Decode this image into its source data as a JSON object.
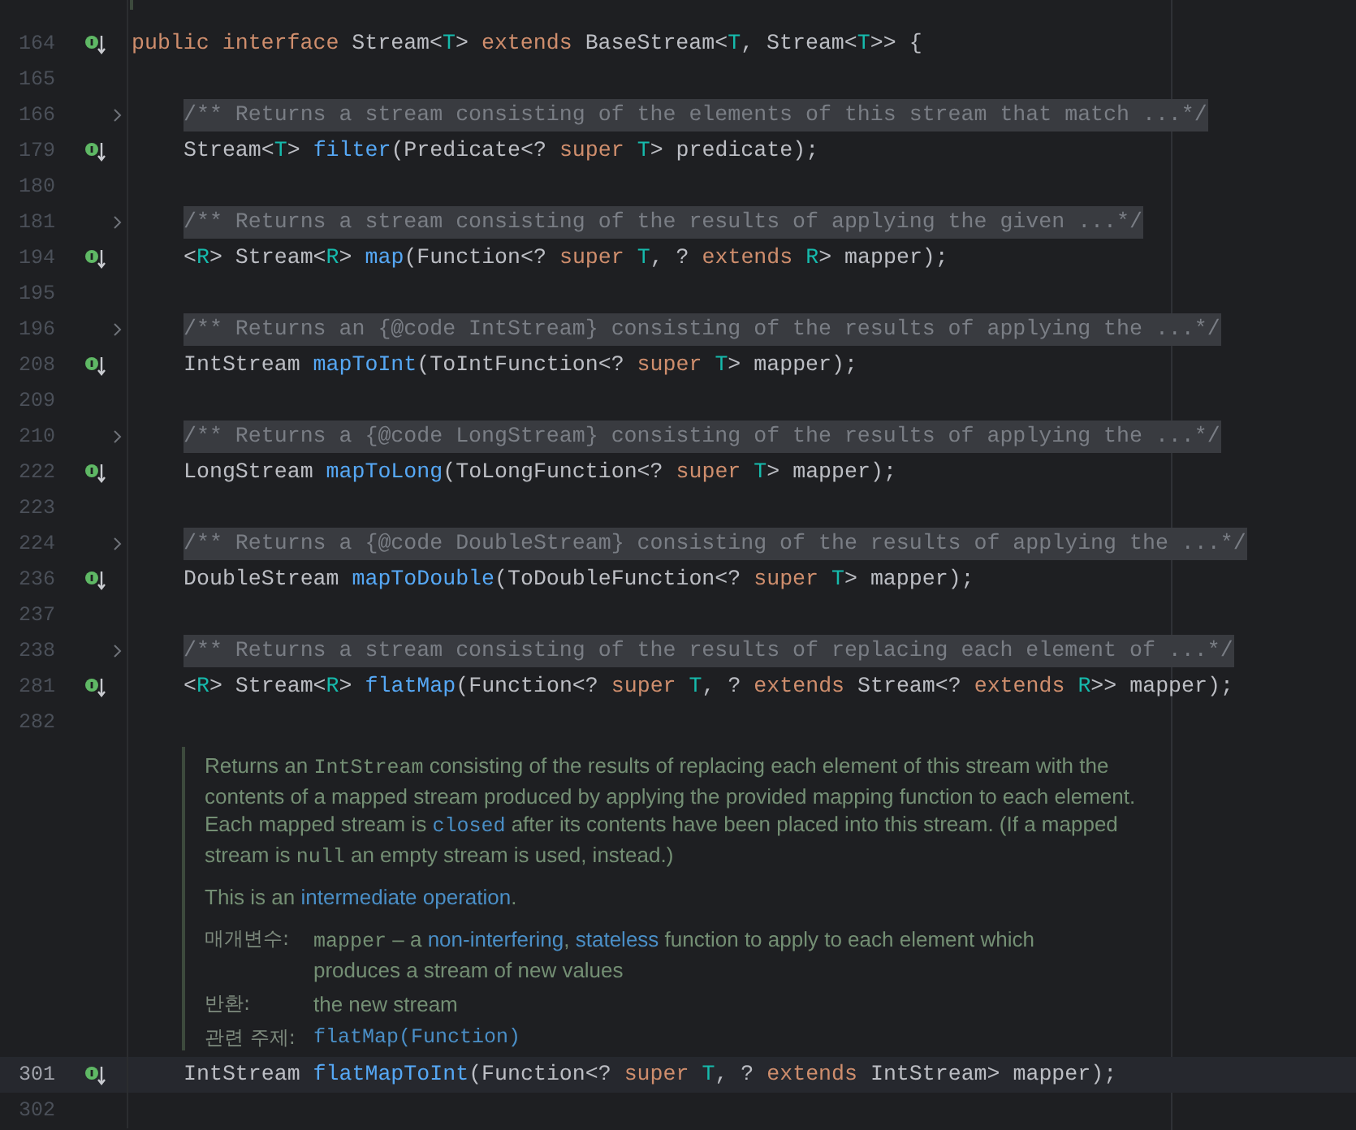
{
  "editor": {
    "lines": [
      {
        "kind": "code",
        "number": "164",
        "implemented": true,
        "tokens": [
          {
            "text": "public ",
            "kind": "keyword"
          },
          {
            "text": "interface ",
            "kind": "keyword"
          },
          {
            "text": "Stream<",
            "kind": "plain"
          },
          {
            "text": "T",
            "kind": "typeparam"
          },
          {
            "text": "> ",
            "kind": "plain"
          },
          {
            "text": "extends ",
            "kind": "keyword"
          },
          {
            "text": "BaseStream<",
            "kind": "plain"
          },
          {
            "text": "T",
            "kind": "typeparam"
          },
          {
            "text": ", Stream<",
            "kind": "plain"
          },
          {
            "text": "T",
            "kind": "typeparam"
          },
          {
            "text": ">> {",
            "kind": "plain"
          }
        ],
        "children": [
          {
            "kind": "blank",
            "number": "165"
          },
          {
            "kind": "folded",
            "number": "166",
            "text": "/** Returns a stream consisting of the elements of this stream that match ...*/"
          },
          {
            "kind": "code",
            "number": "179",
            "implemented": true,
            "tokens": [
              {
                "text": "Stream<",
                "kind": "plain"
              },
              {
                "text": "T",
                "kind": "typeparam"
              },
              {
                "text": "> ",
                "kind": "plain"
              },
              {
                "text": "filter",
                "kind": "method"
              },
              {
                "text": "(Predicate<? ",
                "kind": "plain"
              },
              {
                "text": "super ",
                "kind": "keyword"
              },
              {
                "text": "T",
                "kind": "typeparam"
              },
              {
                "text": "> predicate);",
                "kind": "plain"
              }
            ]
          },
          {
            "kind": "blank",
            "number": "180"
          },
          {
            "kind": "folded",
            "number": "181",
            "text": "/** Returns a stream consisting of the results of applying the given ...*/"
          },
          {
            "kind": "code",
            "number": "194",
            "implemented": true,
            "tokens": [
              {
                "text": "<",
                "kind": "plain"
              },
              {
                "text": "R",
                "kind": "typeparam"
              },
              {
                "text": "> Stream<",
                "kind": "plain"
              },
              {
                "text": "R",
                "kind": "typeparam"
              },
              {
                "text": "> ",
                "kind": "plain"
              },
              {
                "text": "map",
                "kind": "method"
              },
              {
                "text": "(Function<? ",
                "kind": "plain"
              },
              {
                "text": "super ",
                "kind": "keyword"
              },
              {
                "text": "T",
                "kind": "typeparam"
              },
              {
                "text": ", ? ",
                "kind": "plain"
              },
              {
                "text": "extends ",
                "kind": "keyword"
              },
              {
                "text": "R",
                "kind": "typeparam"
              },
              {
                "text": "> mapper);",
                "kind": "plain"
              }
            ]
          },
          {
            "kind": "blank",
            "number": "195"
          },
          {
            "kind": "folded",
            "number": "196",
            "text": "/** Returns an {@code IntStream} consisting of the results of applying the ...*/"
          },
          {
            "kind": "code",
            "number": "208",
            "implemented": true,
            "tokens": [
              {
                "text": "IntStream ",
                "kind": "plain"
              },
              {
                "text": "mapToInt",
                "kind": "method"
              },
              {
                "text": "(ToIntFunction<? ",
                "kind": "plain"
              },
              {
                "text": "super ",
                "kind": "keyword"
              },
              {
                "text": "T",
                "kind": "typeparam"
              },
              {
                "text": "> mapper);",
                "kind": "plain"
              }
            ]
          },
          {
            "kind": "blank",
            "number": "209"
          },
          {
            "kind": "folded",
            "number": "210",
            "text": "/** Returns a {@code LongStream} consisting of the results of applying the ...*/"
          },
          {
            "kind": "code",
            "number": "222",
            "implemented": true,
            "tokens": [
              {
                "text": "LongStream ",
                "kind": "plain"
              },
              {
                "text": "mapToLong",
                "kind": "method"
              },
              {
                "text": "(ToLongFunction<? ",
                "kind": "plain"
              },
              {
                "text": "super ",
                "kind": "keyword"
              },
              {
                "text": "T",
                "kind": "typeparam"
              },
              {
                "text": "> mapper);",
                "kind": "plain"
              }
            ]
          },
          {
            "kind": "blank",
            "number": "223"
          },
          {
            "kind": "folded",
            "number": "224",
            "text": "/** Returns a {@code DoubleStream} consisting of the results of applying the ...*/"
          },
          {
            "kind": "code",
            "number": "236",
            "implemented": true,
            "tokens": [
              {
                "text": "DoubleStream ",
                "kind": "plain"
              },
              {
                "text": "mapToDouble",
                "kind": "method"
              },
              {
                "text": "(ToDoubleFunction<? ",
                "kind": "plain"
              },
              {
                "text": "super ",
                "kind": "keyword"
              },
              {
                "text": "T",
                "kind": "typeparam"
              },
              {
                "text": "> mapper);",
                "kind": "plain"
              }
            ]
          },
          {
            "kind": "blank",
            "number": "237"
          },
          {
            "kind": "folded",
            "number": "238",
            "text": "/** Returns a stream consisting of the results of replacing each element of ...*/"
          },
          {
            "kind": "code",
            "number": "281",
            "implemented": true,
            "tokens": [
              {
                "text": "<",
                "kind": "plain"
              },
              {
                "text": "R",
                "kind": "typeparam"
              },
              {
                "text": "> Stream<",
                "kind": "plain"
              },
              {
                "text": "R",
                "kind": "typeparam"
              },
              {
                "text": "> ",
                "kind": "plain"
              },
              {
                "text": "flatMap",
                "kind": "method"
              },
              {
                "text": "(Function<? ",
                "kind": "plain"
              },
              {
                "text": "super ",
                "kind": "keyword"
              },
              {
                "text": "T",
                "kind": "typeparam"
              },
              {
                "text": ", ? ",
                "kind": "plain"
              },
              {
                "text": "extends ",
                "kind": "keyword"
              },
              {
                "text": "Stream<? ",
                "kind": "plain"
              },
              {
                "text": "extends ",
                "kind": "keyword"
              },
              {
                "text": "R",
                "kind": "typeparam"
              },
              {
                "text": ">> mapper);",
                "kind": "plain"
              }
            ]
          },
          {
            "kind": "blank",
            "number": "282"
          },
          {
            "kind": "doc",
            "paragraphs": [
              [
                {
                  "text": "Returns an ",
                  "kind": "text"
                },
                {
                  "text": "IntStream",
                  "kind": "code"
                },
                {
                  "text": " consisting of the results of replacing each element of this stream with the contents of a mapped stream produced by applying the provided mapping function to each element. Each mapped stream is ",
                  "kind": "text"
                },
                {
                  "text": "closed",
                  "kind": "codelink"
                },
                {
                  "text": " after its contents have been placed into this stream. (If a mapped stream is ",
                  "kind": "text"
                },
                {
                  "text": "null",
                  "kind": "code"
                },
                {
                  "text": " an empty stream is used, instead.)",
                  "kind": "text"
                }
              ],
              [
                {
                  "text": "This is an ",
                  "kind": "text"
                },
                {
                  "text": "intermediate operation",
                  "kind": "link"
                },
                {
                  "text": ".",
                  "kind": "text"
                }
              ]
            ],
            "tags": [
              {
                "label": "매개변수:",
                "value": [
                  {
                    "text": "mapper",
                    "kind": "code"
                  },
                  {
                    "text": " – a ",
                    "kind": "text"
                  },
                  {
                    "text": "non-interfering",
                    "kind": "link"
                  },
                  {
                    "text": ", ",
                    "kind": "text"
                  },
                  {
                    "text": "stateless",
                    "kind": "link"
                  },
                  {
                    "text": " function to apply to each element which produces a stream of new values",
                    "kind": "text"
                  }
                ]
              },
              {
                "label": "반환:",
                "value": [
                  {
                    "text": "the new stream",
                    "kind": "text"
                  }
                ]
              },
              {
                "label": "관련 주제:",
                "value": [
                  {
                    "text": "flatMap(Function)",
                    "kind": "codelink"
                  }
                ]
              }
            ]
          },
          {
            "kind": "code",
            "number": "301",
            "implemented": true,
            "current": true,
            "tokens": [
              {
                "text": "IntStream ",
                "kind": "plain"
              },
              {
                "text": "flatMapToInt",
                "kind": "method"
              },
              {
                "text": "(Function<? ",
                "kind": "plain"
              },
              {
                "text": "super ",
                "kind": "keyword"
              },
              {
                "text": "T",
                "kind": "typeparam"
              },
              {
                "text": ", ? ",
                "kind": "plain"
              },
              {
                "text": "extends ",
                "kind": "keyword"
              },
              {
                "text": "IntStream> mapper);",
                "kind": "plain"
              }
            ]
          },
          {
            "kind": "blank",
            "number": "302"
          }
        ]
      }
    ]
  }
}
